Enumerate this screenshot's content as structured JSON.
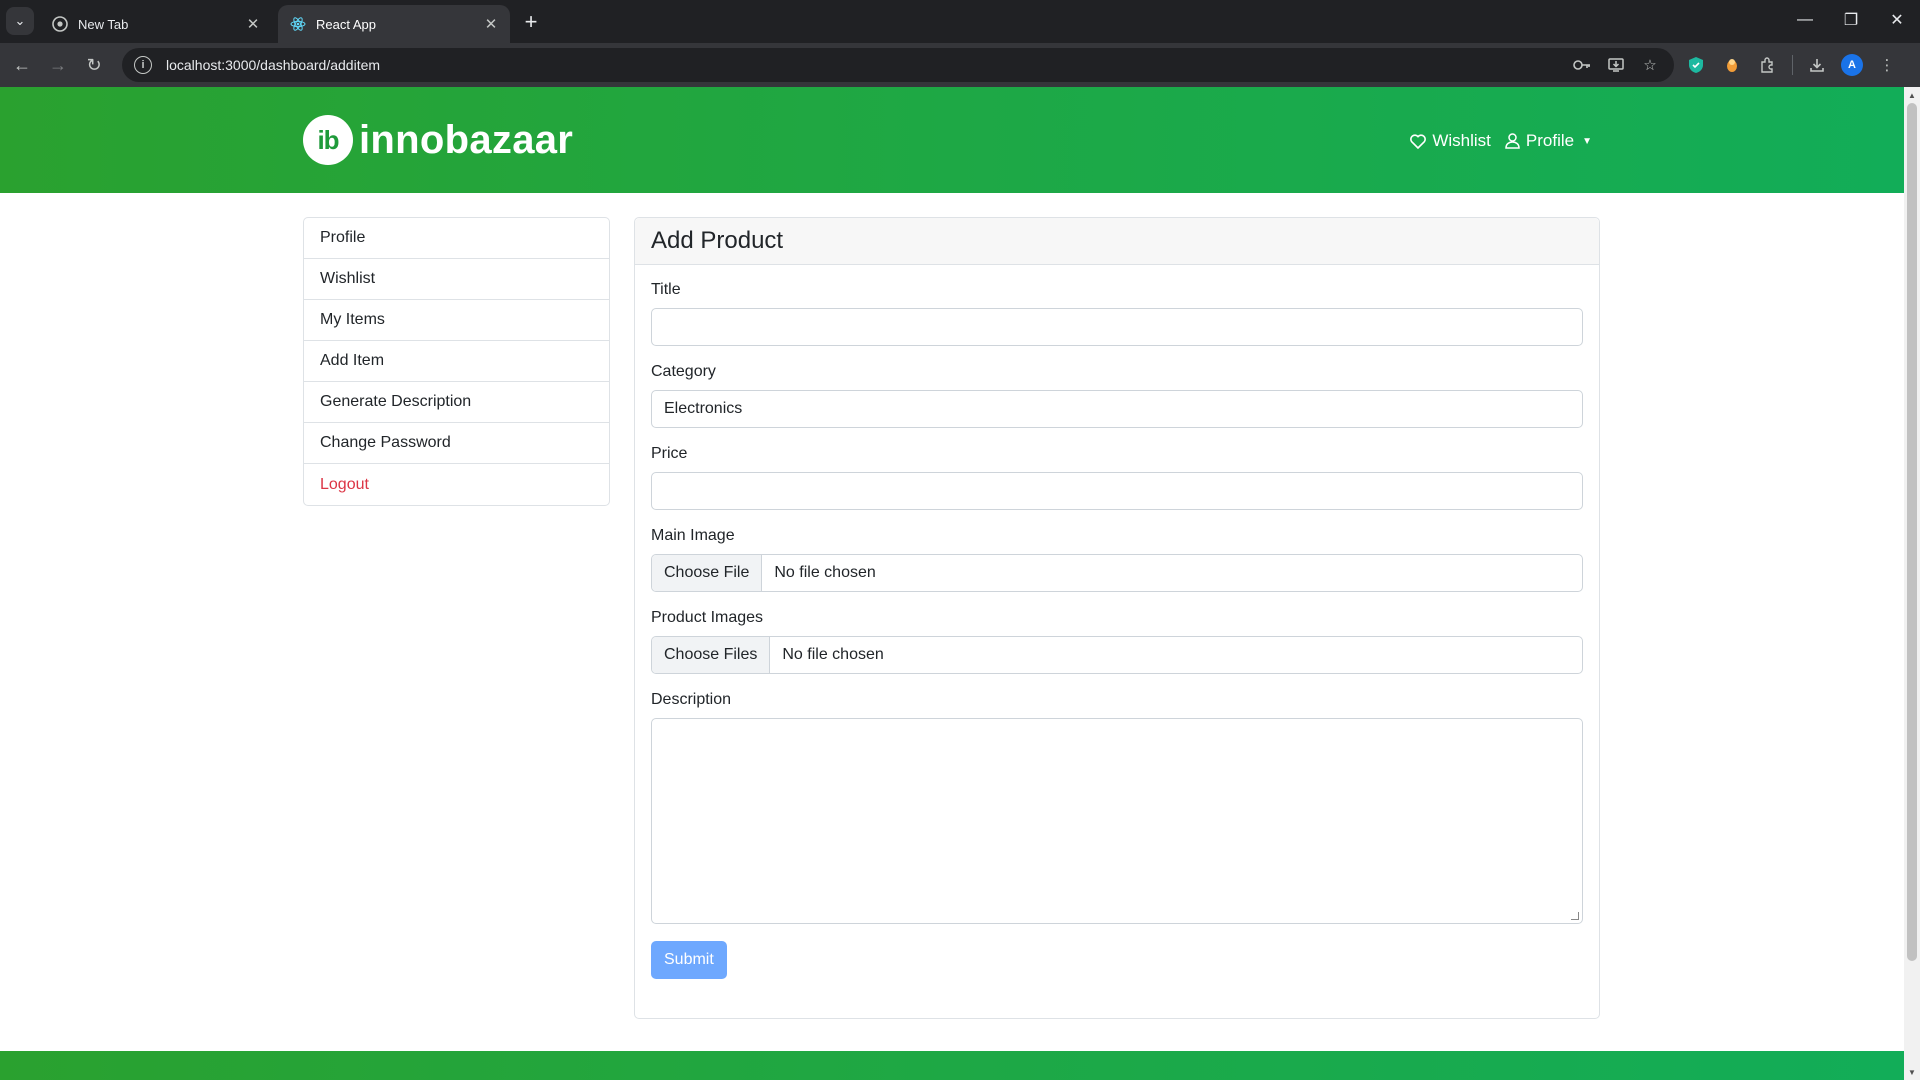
{
  "browser": {
    "tabs": [
      {
        "title": "New Tab",
        "active": false
      },
      {
        "title": "React App",
        "active": true
      }
    ],
    "url": "localhost:3000/dashboard/additem",
    "profile_initial": "A"
  },
  "header": {
    "logo_mark": "ib",
    "logo_text": "innobazaar",
    "wishlist_label": "Wishlist",
    "profile_label": "Profile"
  },
  "sidebar": {
    "items": [
      {
        "label": "Profile"
      },
      {
        "label": "Wishlist"
      },
      {
        "label": "My Items"
      },
      {
        "label": "Add Item"
      },
      {
        "label": "Generate Description"
      },
      {
        "label": "Change Password"
      },
      {
        "label": "Logout"
      }
    ]
  },
  "form": {
    "heading": "Add Product",
    "title_label": "Title",
    "title_value": "",
    "category_label": "Category",
    "category_value": "Electronics",
    "price_label": "Price",
    "price_value": "",
    "main_image_label": "Main Image",
    "main_image_button": "Choose File",
    "main_image_status": "No file chosen",
    "product_images_label": "Product Images",
    "product_images_button": "Choose Files",
    "product_images_status": "No file chosen",
    "description_label": "Description",
    "description_value": "",
    "submit_label": "Submit"
  },
  "colors": {
    "header_green": "#1ea845",
    "logout_red": "#dc3545",
    "submit_blue": "#6ea8fe"
  }
}
